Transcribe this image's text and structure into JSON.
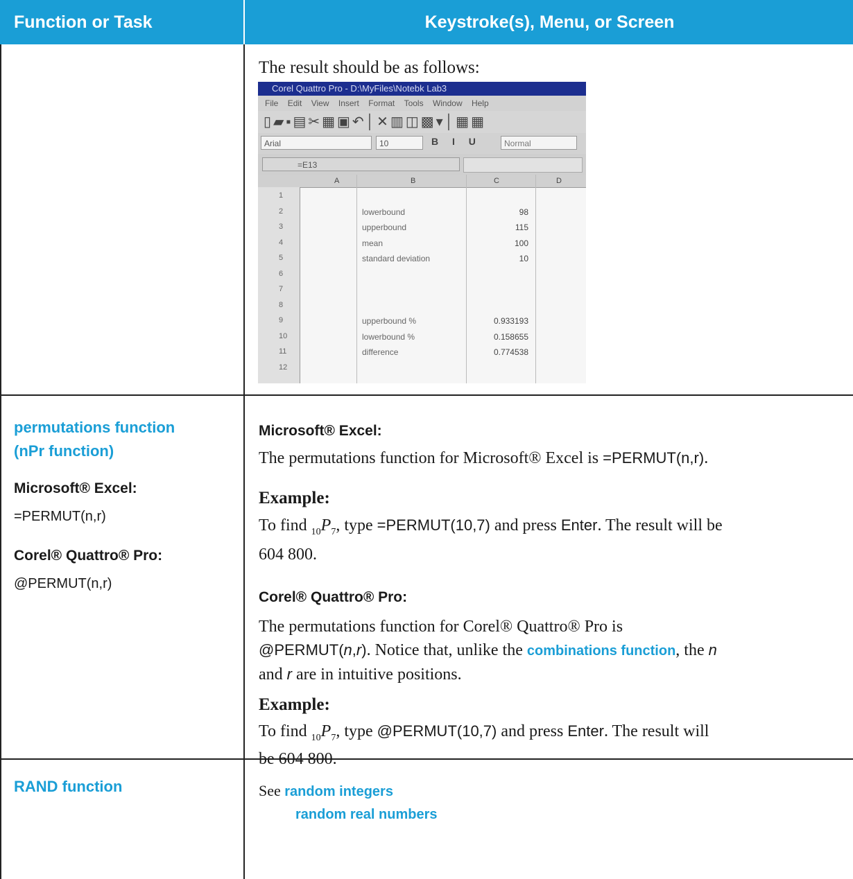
{
  "header": {
    "col1": "Function or Task",
    "col2": "Keystroke(s), Menu, or Screen"
  },
  "row1": {
    "intro": "The result should be as follows:",
    "screenshot": {
      "title": "Corel Quattro Pro - D:\\MyFiles\\Notebk Lab3",
      "menu": [
        "File",
        "Edit",
        "View",
        "Insert",
        "Format",
        "Tools",
        "Window",
        "Help"
      ],
      "font": "Arial",
      "size": "10",
      "style": "Normal",
      "cell_ref": "=E13",
      "columns": [
        "A",
        "B",
        "C",
        "D"
      ],
      "rows": [
        {
          "n": "1",
          "b": "",
          "c": ""
        },
        {
          "n": "2",
          "b": "lowerbound",
          "c": "98"
        },
        {
          "n": "3",
          "b": "upperbound",
          "c": "115"
        },
        {
          "n": "4",
          "b": "mean",
          "c": "100"
        },
        {
          "n": "5",
          "b": "standard deviation",
          "c": "10"
        },
        {
          "n": "6",
          "b": "",
          "c": ""
        },
        {
          "n": "7",
          "b": "",
          "c": ""
        },
        {
          "n": "8",
          "b": "",
          "c": ""
        },
        {
          "n": "9",
          "b": "upperbound %",
          "c": "0.933193"
        },
        {
          "n": "10",
          "b": "lowerbound %",
          "c": "0.158655"
        },
        {
          "n": "11",
          "b": "difference",
          "c": "0.774538"
        },
        {
          "n": "12",
          "b": "",
          "c": ""
        }
      ]
    }
  },
  "row2": {
    "left": {
      "title_line1": "permutations function",
      "title_line2": "(nPr function)",
      "excel_label": "Microsoft® Excel:",
      "excel_formula": "=PERMUT(n,r)",
      "corel_label": "Corel® Quattro® Pro:",
      "corel_formula": "@PERMUT(n,r)"
    },
    "right": {
      "excel_heading": "Microsoft® Excel:",
      "excel_text_a": "The permutations function for Microsoft® Excel is ",
      "excel_text_code": "=PERMUT(n,r)",
      "excel_text_b": ".",
      "example1_heading": "Example:",
      "ex1_a": "To find ",
      "ex1_sub_pre": "10",
      "ex1_P": "P",
      "ex1_sub_post": "7",
      "ex1_b": ", type ",
      "ex1_code": "=PERMUT(10,7)",
      "ex1_c": " and press ",
      "ex1_key": "Enter",
      "ex1_d": ". The result will be",
      "ex1_e": "604 800.",
      "corel_heading": "Corel® Quattro® Pro:",
      "corel_text_a": "The permutations function for Corel® Quattro® Pro is",
      "corel_code_a": "@PERMUT(",
      "corel_code_n": "n",
      "corel_code_comma": ",",
      "corel_code_r": "r",
      "corel_code_close": ")",
      "corel_text_b": ". Notice that, unlike the ",
      "corel_link": "combinations function",
      "corel_text_c": ", the ",
      "corel_n": "n",
      "corel_text_d": "and ",
      "corel_r": "r",
      "corel_text_e": " are in intuitive positions.",
      "example2_heading": "Example:",
      "ex2_a": "To find ",
      "ex2_sub_pre": "10",
      "ex2_P": "P",
      "ex2_sub_post": "7",
      "ex2_b": ", type ",
      "ex2_code": "@PERMUT(10,7)",
      "ex2_c": " and press ",
      "ex2_key": "Enter",
      "ex2_d": ". The result will",
      "ex2_e": "be 604 800."
    }
  },
  "row3": {
    "left_title": "RAND function",
    "see": "See ",
    "link1": "random integers",
    "link2": "random real numbers"
  },
  "colors": {
    "accent": "#1a9ed6",
    "rule": "#222222"
  }
}
